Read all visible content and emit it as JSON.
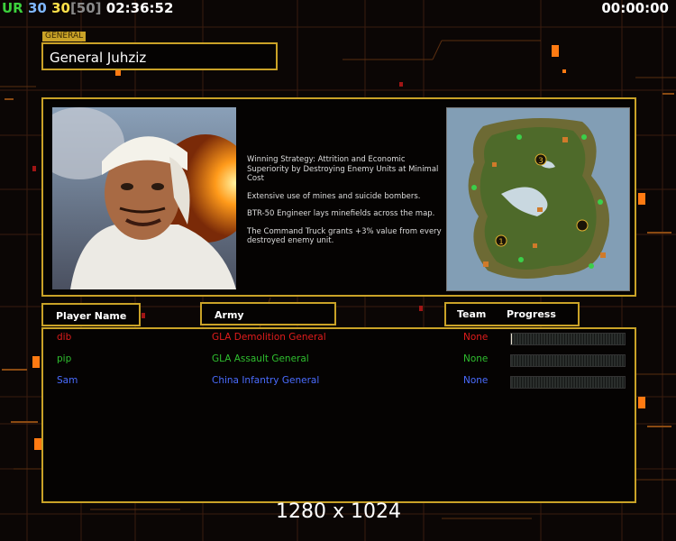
{
  "hud": {
    "ur_label": "UR",
    "count_a": "30",
    "count_b": "30",
    "count_max": "[50]",
    "clock": "02:36:52",
    "timer": "00:00:00"
  },
  "general": {
    "tag": "GENERAL",
    "name": "General Juhziz"
  },
  "description": [
    "Winning Strategy: Attrition and Economic Superiority by Destroying Enemy Units at Minimal Cost",
    "Extensive use of mines and suicide bombers.",
    "BTR-50 Engineer lays minefields across the map.",
    "The Command Truck grants +3% value from every destroyed enemy unit."
  ],
  "map": {
    "start_markers": [
      "3",
      "1",
      ""
    ]
  },
  "headers": {
    "player_name": "Player Name",
    "army": "Army",
    "team": "Team",
    "progress": "Progress"
  },
  "players": [
    {
      "name": "dib",
      "army": "GLA Demolition General",
      "team": "None",
      "color": "#e01c1c",
      "progress": 0.01
    },
    {
      "name": "pip",
      "army": "GLA Assault General",
      "team": "None",
      "color": "#2fbf2f",
      "progress": 0
    },
    {
      "name": "Sam",
      "army": "China Infantry General",
      "team": "None",
      "color": "#4a6cff",
      "progress": 0
    }
  ],
  "footer": {
    "resolution": "1280 x 1024"
  },
  "colors": {
    "accent": "#c9a227",
    "ur_green": "#3cd13c",
    "count_blue": "#7fb7ff",
    "count_yellow": "#ffe04a",
    "count_gray": "#8a8a8a"
  }
}
